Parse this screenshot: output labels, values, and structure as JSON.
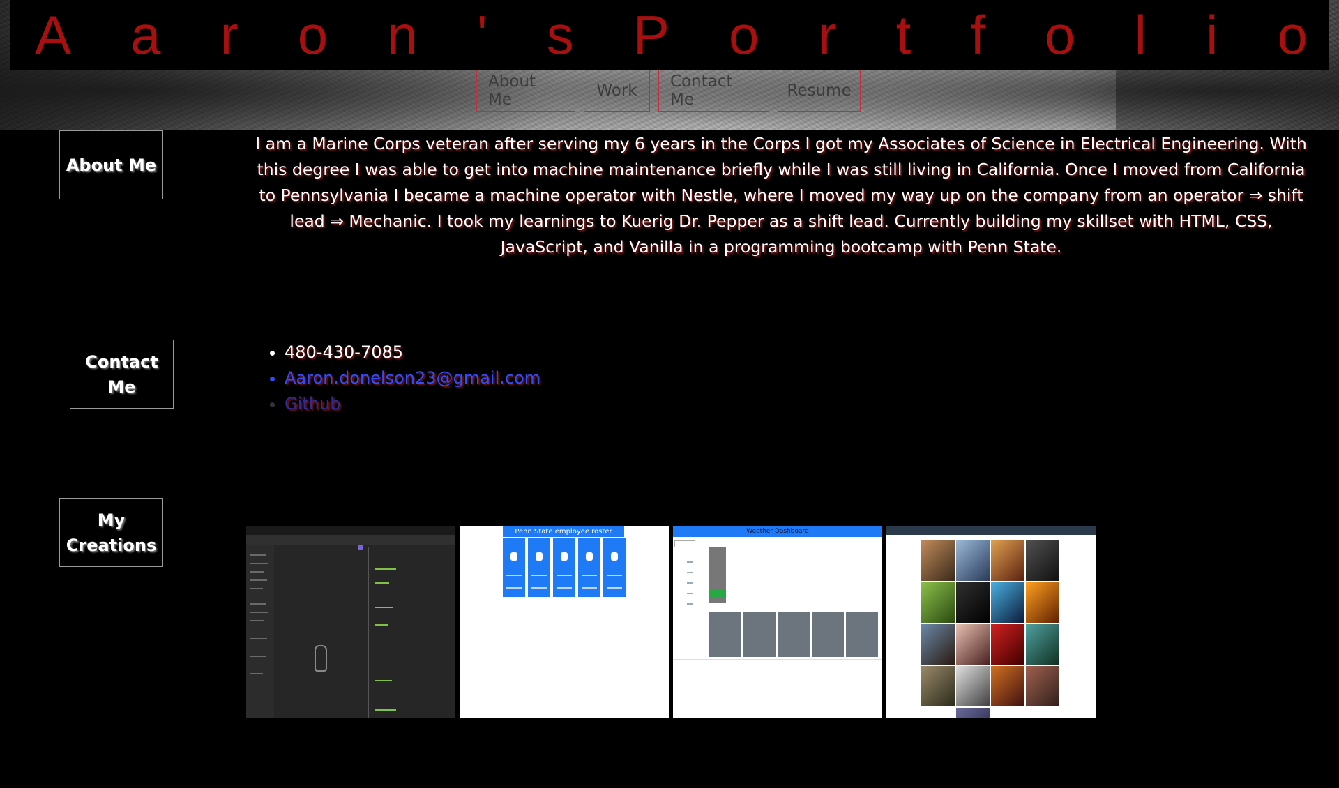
{
  "header": {
    "title_letters": [
      "A",
      "a",
      "r",
      "o",
      "n",
      "'",
      "s",
      "P",
      "o",
      "r",
      "t",
      "f",
      "o",
      "l",
      "i",
      "o"
    ],
    "title_color": "#a80f0f"
  },
  "nav": {
    "items": [
      {
        "label": "About Me"
      },
      {
        "label": "Work"
      },
      {
        "label": "Contact Me"
      },
      {
        "label": "Resume"
      }
    ],
    "border_color": "#c0303a"
  },
  "sections": {
    "about": {
      "label": "About Me",
      "text": "I am a Marine Corps veteran after serving my 6 years in the Corps I got my Associates of Science in Electrical Engineering. With this degree I was able to get into machine maintenance briefly while I was still living in California. Once I moved from California to Pennsylvania I became a machine operator with Nestle, where I moved my way up on the company from an operator ⇒ shift lead ⇒ Mechanic. I took my learnings to Kuerig Dr. Pepper as a shift lead. Currently building my skillset with HTML, CSS, JavaScript, and Vanilla in a programming bootcamp with Penn State."
    },
    "contact": {
      "label": "Contact Me",
      "phone": "480-430-7085",
      "email": "Aaron.donelson23@gmail.com",
      "github": "Github"
    },
    "creations": {
      "label_line1": "My",
      "label_line2": "Creations",
      "thumbs": [
        {
          "name": "code-editor-screenshot"
        },
        {
          "name": "employee-roster-screenshot",
          "header": "Penn State employee roster"
        },
        {
          "name": "weather-dashboard-screenshot",
          "header": "Weather Dashboard"
        },
        {
          "name": "game-gallery-screenshot"
        }
      ]
    }
  }
}
